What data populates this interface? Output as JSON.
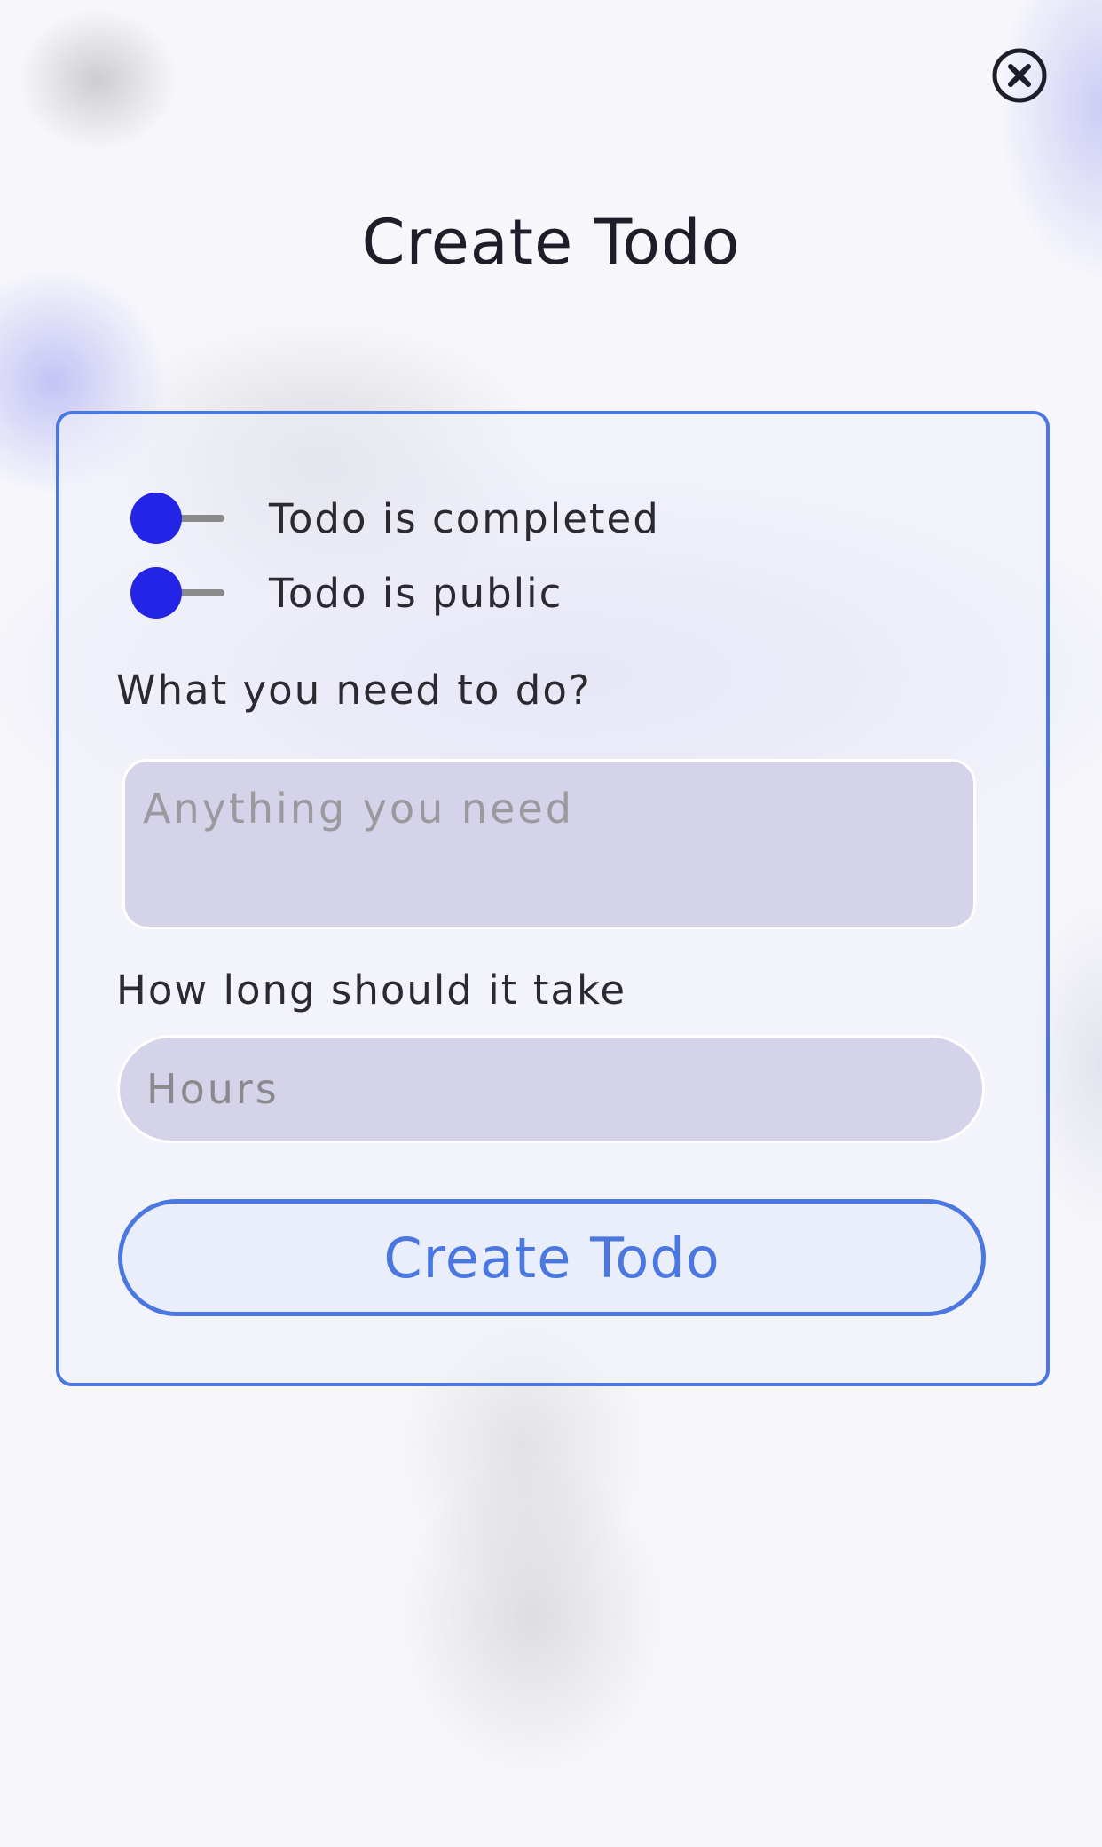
{
  "header": {
    "title": "Create Todo",
    "close_icon": "close-circle-icon"
  },
  "form": {
    "toggles": [
      {
        "label": "Todo is completed",
        "checked": false
      },
      {
        "label": "Todo is public",
        "checked": false
      }
    ],
    "task": {
      "label": "What you need to do?",
      "placeholder": "Anything you need",
      "value": ""
    },
    "duration": {
      "label": "How long should it take",
      "placeholder": "Hours",
      "value": ""
    },
    "submit_label": "Create Todo"
  },
  "colors": {
    "accent": "#4a78e0",
    "toggle_knob": "#2424e6",
    "toggle_track": "#8a8a8a",
    "input_bg": "#d4d3e9",
    "text": "#1e1e2a"
  }
}
